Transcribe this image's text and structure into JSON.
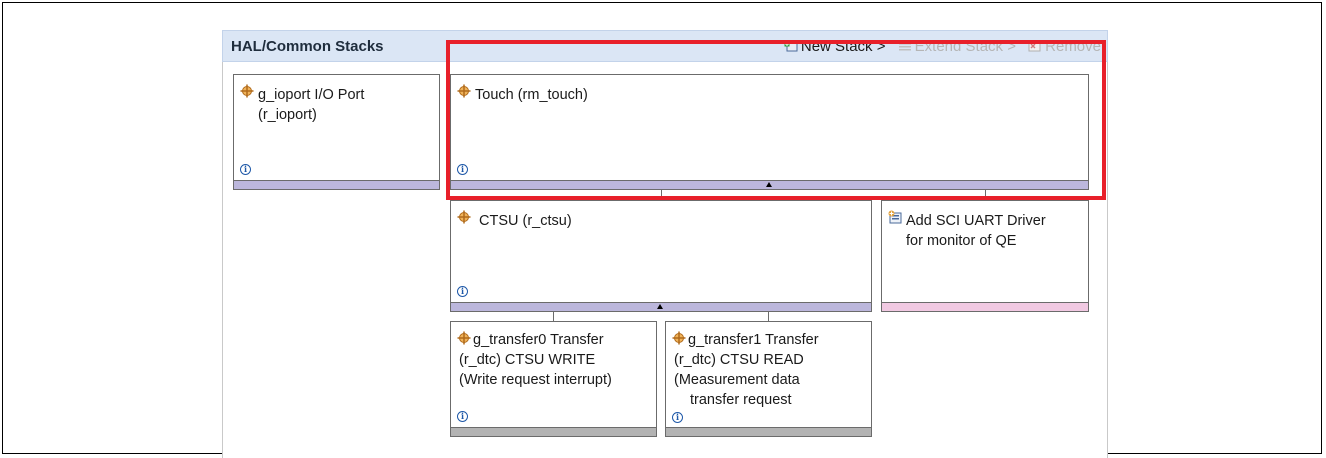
{
  "panel": {
    "title": "HAL/Common Stacks"
  },
  "toolbar": {
    "new_stack": "New Stack >",
    "extend_stack": "Extend Stack >",
    "remove": "Remove"
  },
  "stacks": {
    "ioport": {
      "line1": "g_ioport I/O Port",
      "line2": "(r_ioport)"
    },
    "touch": {
      "line1": "Touch (rm_touch)"
    },
    "ctsu": {
      "line1": "CTSU (r_ctsu)"
    },
    "sci_uart": {
      "line1": "Add SCI UART Driver",
      "line2": "for monitor of QE"
    },
    "transfer0": {
      "line1": "g_transfer0 Transfer",
      "line2": "(r_dtc) CTSU WRITE",
      "line3": "(Write request interrupt)"
    },
    "transfer1": {
      "line1": "g_transfer1 Transfer",
      "line2": "(r_dtc) CTSU READ",
      "line3": "(Measurement data",
      "line4": "transfer request"
    }
  },
  "icons": {
    "module": "module-icon",
    "info": "info-icon",
    "add_driver": "add-driver-icon",
    "new_stack": "new-stack-icon",
    "extend_stack": "extend-stack-icon",
    "remove": "remove-icon"
  },
  "colors": {
    "highlight": "#e8202a",
    "header_bg": "#dbe6f5",
    "bar_lavender": "#bcb7dc",
    "bar_pink": "#f1c9e2",
    "bar_gray": "#b3b3b3",
    "info_blue": "#1e58a8"
  }
}
